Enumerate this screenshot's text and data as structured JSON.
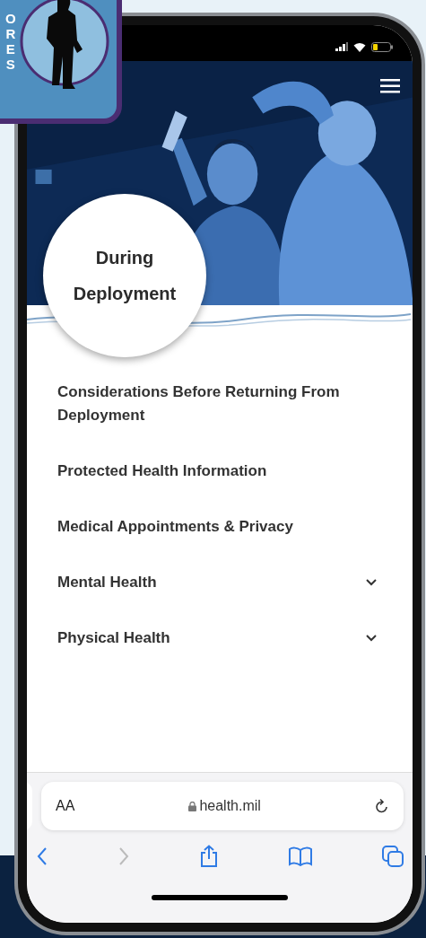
{
  "badge": {
    "letters": "ORES"
  },
  "hero": {
    "title": "During Deployment"
  },
  "menu": [
    {
      "label": "Considerations Before Returning From Deployment",
      "kind": "link"
    },
    {
      "label": "Protected Health Information",
      "kind": "link"
    },
    {
      "label": "Medical Appointments & Privacy",
      "kind": "link"
    },
    {
      "label": "Mental Health",
      "kind": "accordion",
      "expanded": false
    },
    {
      "label": "Physical Health",
      "kind": "accordion",
      "expanded": false
    }
  ],
  "browser": {
    "text_size": "AA",
    "address": "health.mil",
    "forward_disabled": true
  }
}
